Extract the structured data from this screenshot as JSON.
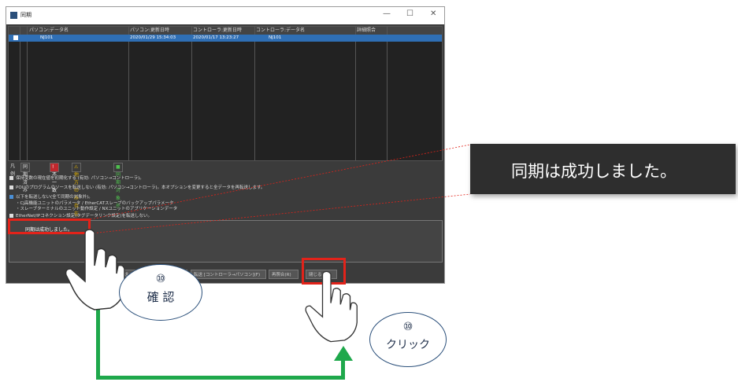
{
  "window": {
    "title": "同期",
    "minimize": "—",
    "maximize": "☐",
    "close": "✕"
  },
  "table": {
    "headers": [
      "パソコン:データ名",
      "パソコン:更新日時",
      "コントローラ:更新日時",
      "コントローラ:データ名",
      "詳細照合"
    ],
    "row": {
      "pc_name": "NJ101",
      "pc_time": "2020/01/29 15:34:03",
      "ctrl_time": "2020/01/17 13:23:27",
      "ctrl_name": "NJ101"
    }
  },
  "legend": {
    "label": "凡例",
    "items": [
      "同期済み",
      "! 不一致",
      "⚠ 他方のみ存在",
      "■ 同期対象外"
    ]
  },
  "options": [
    "保持変数の現在値を初期化する (有効: パソコン→コントローラ)。",
    "POUのプログラムのソースを転送しない (有効: パソコン→コントローラ)。本オプションを変更すると全データを再転送します。",
    "以下を転送しない(全て同期の対象外)。",
    "・CJ高機能ユニットのパラメータ / EtherCATスレーブのバックアップパラメータ",
    "・スレーブターミナルのユニット動作設定 / NXユニットのアプリケーションデータ",
    "EtherNet/IPコネクション設定(タグデータリンク設定)を転送しない。"
  ],
  "message": "同期は成功しました。",
  "buttons": {
    "transfer_to": "転送",
    "transfer_from": "転送 [コントローラ→パソコン](F)",
    "recompare": "再照合(R)",
    "close": "閉じる(C)"
  },
  "zoom_text": "同期は成功しました。",
  "callout_confirm": {
    "number": "⑩",
    "label": "確 認"
  },
  "callout_click": {
    "number": "⑩",
    "label": "クリック"
  }
}
